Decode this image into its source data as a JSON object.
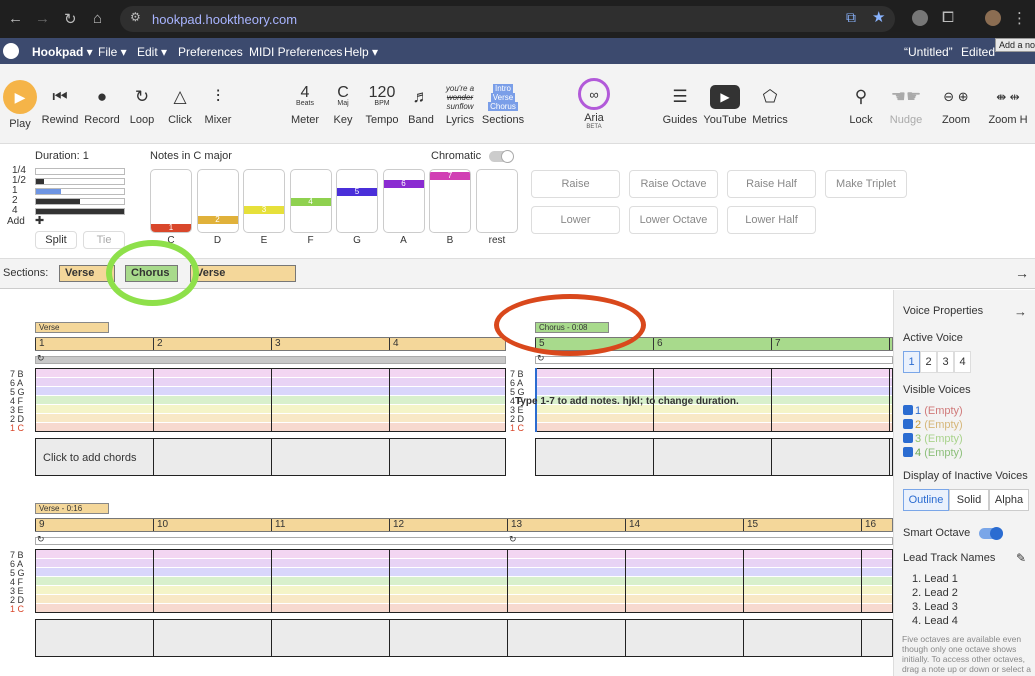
{
  "browser": {
    "url": "hookpad.hooktheory.com",
    "tooltip": "Add a no"
  },
  "menu": {
    "app": "Hookpad ▾",
    "file": "File ▾",
    "edit": "Edit ▾",
    "preferences": "Preferences",
    "midi": "MIDI Preferences",
    "help": "Help ▾",
    "doc_title": "“Untitled”",
    "status": "Edited"
  },
  "toolbar": {
    "play": "Play",
    "rewind": "Rewind",
    "record": "Record",
    "loop": "Loop",
    "click": "Click",
    "mixer": "Mixer",
    "meter_value": "4",
    "meter_sub": "Beats",
    "meter": "Meter",
    "key_value": "C",
    "key_sub": "Maj",
    "key": "Key",
    "tempo_value": "120",
    "tempo_sub": "BPM",
    "tempo": "Tempo",
    "band": "Band",
    "lyrics": "Lyrics",
    "lyrics_icon_lines": [
      "you're a",
      "wonder",
      "sunflow"
    ],
    "sections": "Sections",
    "sections_icon_lines": [
      "Intro",
      "Verse",
      "Chorus"
    ],
    "aria": "Aria",
    "aria_badge": "BETA",
    "guides": "Guides",
    "youtube": "YouTube",
    "metrics": "Metrics",
    "lock": "Lock",
    "nudge": "Nudge",
    "zoom": "Zoom",
    "zoomh": "Zoom H"
  },
  "notes": {
    "duration": "Duration: 1",
    "dur_labels": [
      "1/4",
      "1/2",
      "1",
      "2",
      "4"
    ],
    "dur_fill": [
      0.0,
      0.09,
      0.28,
      0.5,
      1.0
    ],
    "add": "Add",
    "split": "Split",
    "tie": "Tie",
    "title": "Notes in C major",
    "chromatic": "Chromatic",
    "keys": [
      {
        "deg": "1",
        "name": "C",
        "color": "#d9472b"
      },
      {
        "deg": "2",
        "name": "D",
        "color": "#e0b13a"
      },
      {
        "deg": "3",
        "name": "E",
        "color": "#e6e03a"
      },
      {
        "deg": "4",
        "name": "F",
        "color": "#8fd14f"
      },
      {
        "deg": "5",
        "name": "G",
        "color": "#4a2fd9"
      },
      {
        "deg": "6",
        "name": "A",
        "color": "#8a2bd1"
      },
      {
        "deg": "7",
        "name": "B",
        "color": "#d13fb4"
      }
    ],
    "rest": "rest",
    "buttons": [
      "Raise",
      "Raise Octave",
      "Raise Half",
      "Make Triplet",
      "Lower",
      "Lower Octave",
      "Lower Half"
    ]
  },
  "sections": {
    "label": "Sections:",
    "items": [
      {
        "name": "Verse",
        "color": "#f4d79a"
      },
      {
        "name": "Chorus",
        "color": "#a8da8c"
      },
      {
        "name": "Verse",
        "color": "#f4d79a"
      }
    ]
  },
  "score": {
    "row1": {
      "verse_label": "Verse",
      "chorus_label": "Chorus - 0:08",
      "measures": [
        "1",
        "2",
        "3",
        "4",
        "5",
        "6",
        "7",
        "8"
      ]
    },
    "row2": {
      "verse_label": "Verse - 0:16",
      "measures": [
        "9",
        "10",
        "11",
        "12",
        "13",
        "14",
        "15",
        "16"
      ]
    },
    "pitch_labels": [
      "7 B",
      "6 A",
      "5 G",
      "4 F",
      "3 E",
      "2 D",
      "1 C"
    ],
    "hint": "Type 1-7 to add notes. hjkl; to change duration.",
    "chord_hint": "Click to add chords",
    "loop_icon": "↻"
  },
  "voice": {
    "title": "Voice Properties",
    "active": "Active Voice",
    "active_voices": [
      "1",
      "2",
      "3",
      "4"
    ],
    "visible": "Visible Voices",
    "visible_list": [
      {
        "num": "1",
        "state": "(Empty)"
      },
      {
        "num": "2",
        "state": "(Empty)"
      },
      {
        "num": "3",
        "state": "(Empty)"
      },
      {
        "num": "4",
        "state": "(Empty)"
      }
    ],
    "inactive": "Display of Inactive Voices",
    "inactive_opts": [
      "Outline",
      "Solid",
      "Alpha"
    ],
    "smart": "Smart Octave",
    "lead_names": "Lead Track Names",
    "leads": [
      "1. Lead 1",
      "2. Lead 2",
      "3. Lead 3",
      "4. Lead 4"
    ],
    "footnote": "Five octaves are available even though only one octave shows initially. To access other octaves, drag a note up or down or select a note in the"
  },
  "colors": {
    "verse": "#f4d79a",
    "chorus": "#a8da8c",
    "menubar": "#3c4a6e",
    "play": "#f5b448",
    "green_circle": "#8ee04a",
    "red_circle": "#d9481c"
  }
}
